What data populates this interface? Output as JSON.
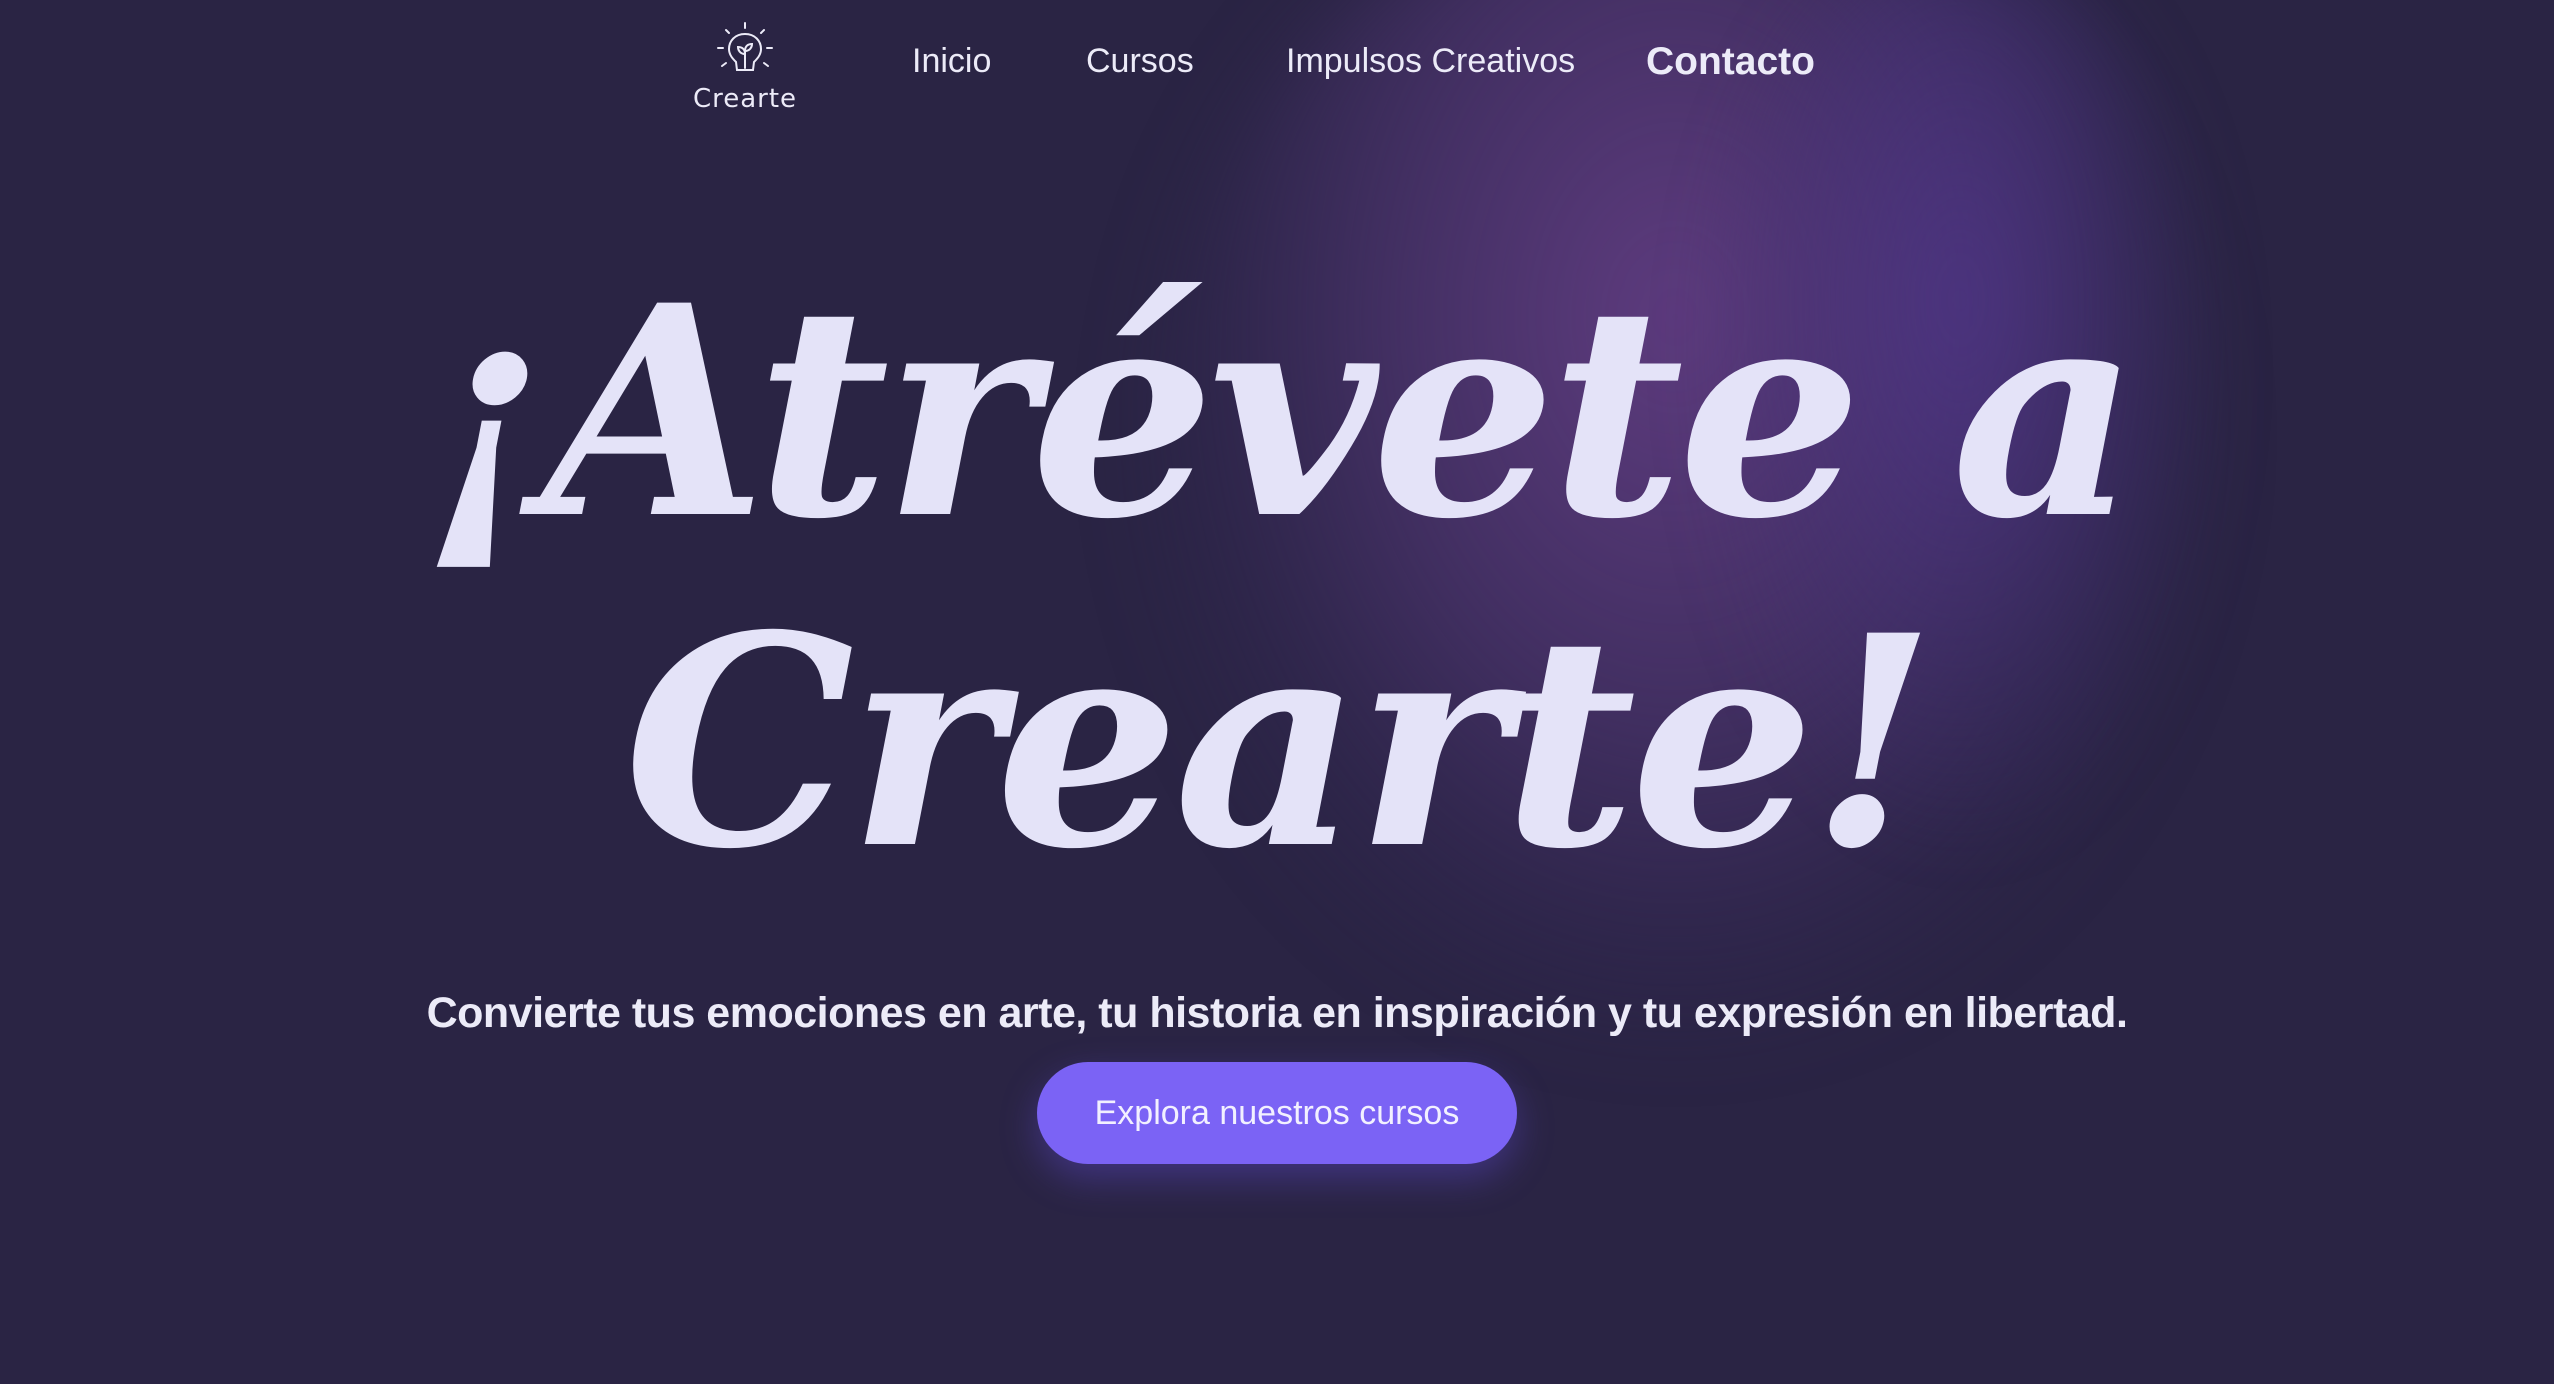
{
  "brand": {
    "name": "Crearte",
    "icon": "lightbulb-sprout-icon"
  },
  "nav": {
    "items": [
      {
        "label": "Inicio",
        "active": false
      },
      {
        "label": "Cursos",
        "active": false
      },
      {
        "label": "Impulsos Creativos",
        "active": false
      },
      {
        "label": "Contacto",
        "active": true
      }
    ]
  },
  "hero": {
    "title_line1": "¡Atrévete a",
    "title_line2": "Crearte!",
    "subtitle": "Convierte tus emociones en arte, tu historia en inspiración y tu expresión en libertad.",
    "cta_label": "Explora nuestros cursos"
  },
  "colors": {
    "background": "#2a2444",
    "glow": "#5a3a78",
    "text": "#e4e3f8",
    "accent": "#7b63f5"
  }
}
